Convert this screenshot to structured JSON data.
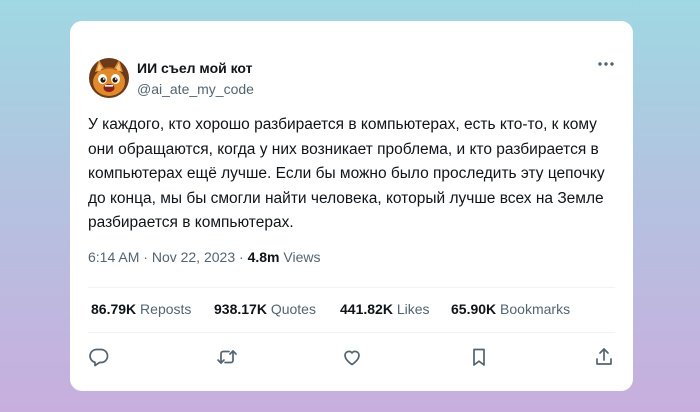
{
  "author": {
    "display_name": "ИИ съел мой кот",
    "handle": "@ai_ate_my_code",
    "avatar_icon": "cat-avatar-icon"
  },
  "tweet": {
    "text": "У каждого, кто хорошо разбирается в компьютерах, есть кто-то, к кому они обращаются, когда у них возникает проблема, и кто разбирается в компьютерах ещё лучше. Если бы можно было проследить эту цепочку до конца, мы бы смогли найти человека, который лучше всех на Земле разбирается в компьютерах.",
    "time": "6:14 AM",
    "separator1": " · ",
    "date": "Nov 22, 2023",
    "separator2": " · ",
    "views_count": "4.8m",
    "views_label": " Views"
  },
  "stats": {
    "reposts_count": "86.79K",
    "reposts_label": " Reposts",
    "quotes_count": "938.17K",
    "quotes_label": " Quotes",
    "likes_count": "441.82K",
    "likes_label": " Likes",
    "bookmarks_count": "65.90K",
    "bookmarks_label": " Bookmarks"
  },
  "actions": [
    "reply-icon",
    "repost-icon",
    "like-icon",
    "bookmark-icon",
    "share-icon"
  ],
  "colors": {
    "text_primary": "#0f1419",
    "text_secondary": "#536471",
    "divider": "#eff3f4",
    "card": "#ffffff"
  }
}
